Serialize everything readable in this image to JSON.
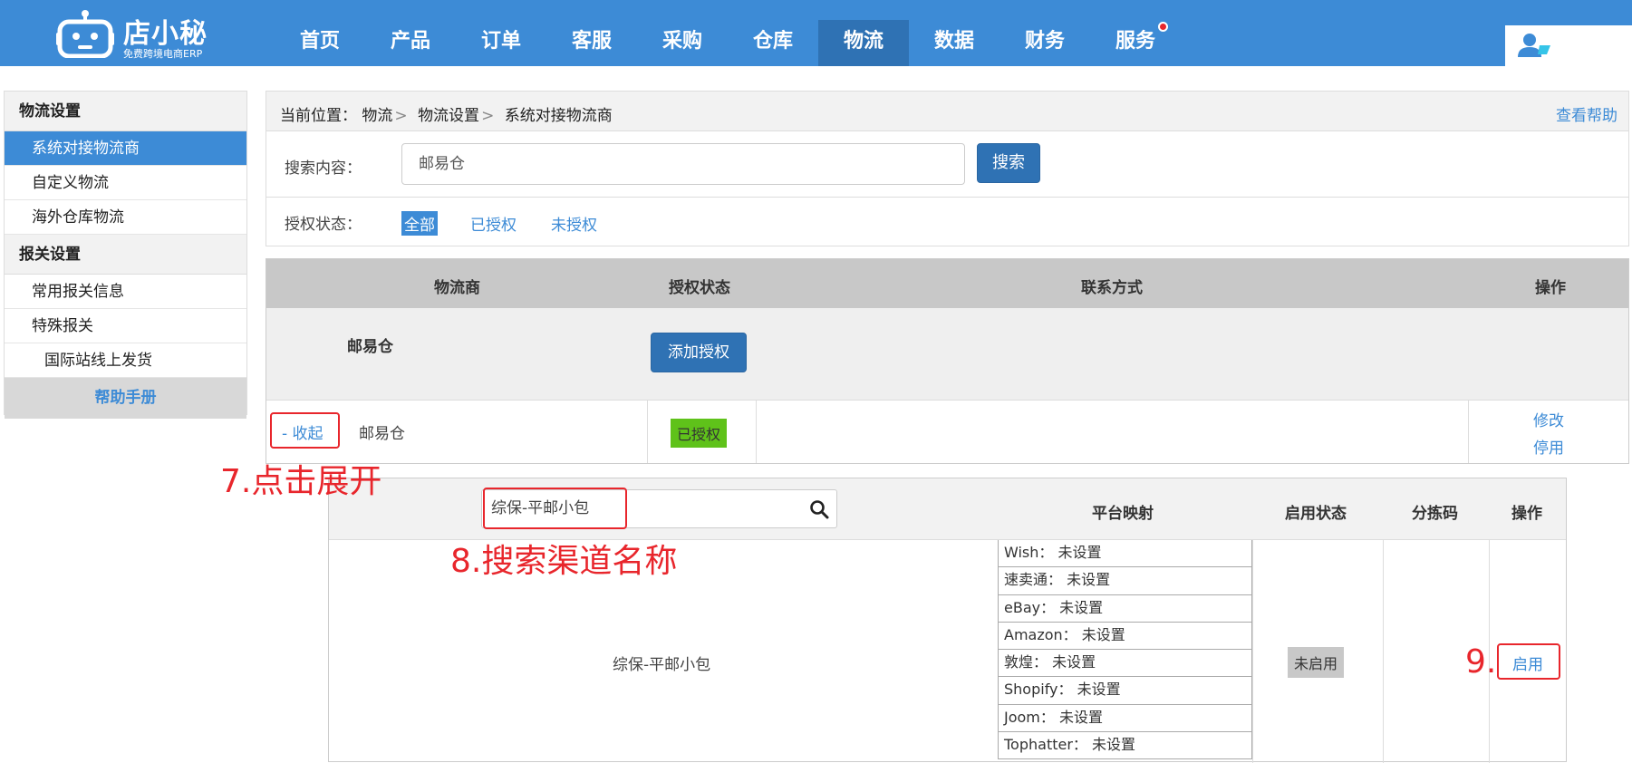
{
  "brand": {
    "name": "店小秘",
    "tagline": "免费跨境电商ERP"
  },
  "nav": {
    "items": [
      "首页",
      "产品",
      "订单",
      "客服",
      "采购",
      "仓库",
      "物流",
      "数据",
      "财务",
      "服务"
    ],
    "active": "物流"
  },
  "sidebar": {
    "group1": "物流设置",
    "items1": [
      "系统对接物流商",
      "自定义物流",
      "海外仓库物流"
    ],
    "group2": "报关设置",
    "items2": [
      "常用报关信息",
      "特殊报关",
      "国际站线上发货"
    ],
    "help": "帮助手册"
  },
  "breadcrumb": {
    "prefix": "当前位置：",
    "items": [
      "物流",
      "物流设置",
      "系统对接物流商"
    ],
    "help_link": "查看帮助"
  },
  "search": {
    "label": "搜索内容：",
    "value": "邮易仓",
    "button": "搜索"
  },
  "auth_filter": {
    "label": "授权状态：",
    "options": [
      "全部",
      "已授权",
      "未授权"
    ],
    "active": "全部"
  },
  "carrier_table": {
    "headers": [
      "物流商",
      "授权状态",
      "联系方式",
      "操作"
    ],
    "group_name": "邮易仓",
    "add_auth_button": "添加授权",
    "row": {
      "toggle": "- 收起",
      "name": "邮易仓",
      "status": "已授权",
      "actions": [
        "修改",
        "停用"
      ]
    }
  },
  "channel_table": {
    "search_value": "综保-平邮小包",
    "headers": [
      "平台映射",
      "启用状态",
      "分拣码",
      "操作"
    ],
    "row": {
      "name": "综保-平邮小包",
      "mappings": [
        "Wish： 未设置",
        "速卖通： 未设置",
        "eBay： 未设置",
        "Amazon： 未设置",
        "敦煌： 未设置",
        "Shopify： 未设置",
        "Joom： 未设置",
        "Tophatter： 未设置"
      ],
      "status": "未启用",
      "action": "启用"
    }
  },
  "annotations": {
    "step7": "7.点击展开",
    "step8": "8.搜索渠道名称",
    "step9": "9."
  },
  "colors": {
    "brand_blue": "#3d8bd6",
    "dark_blue": "#2f72b4",
    "annotation_red": "#e8262c",
    "authorized_green": "#5fc21a"
  }
}
